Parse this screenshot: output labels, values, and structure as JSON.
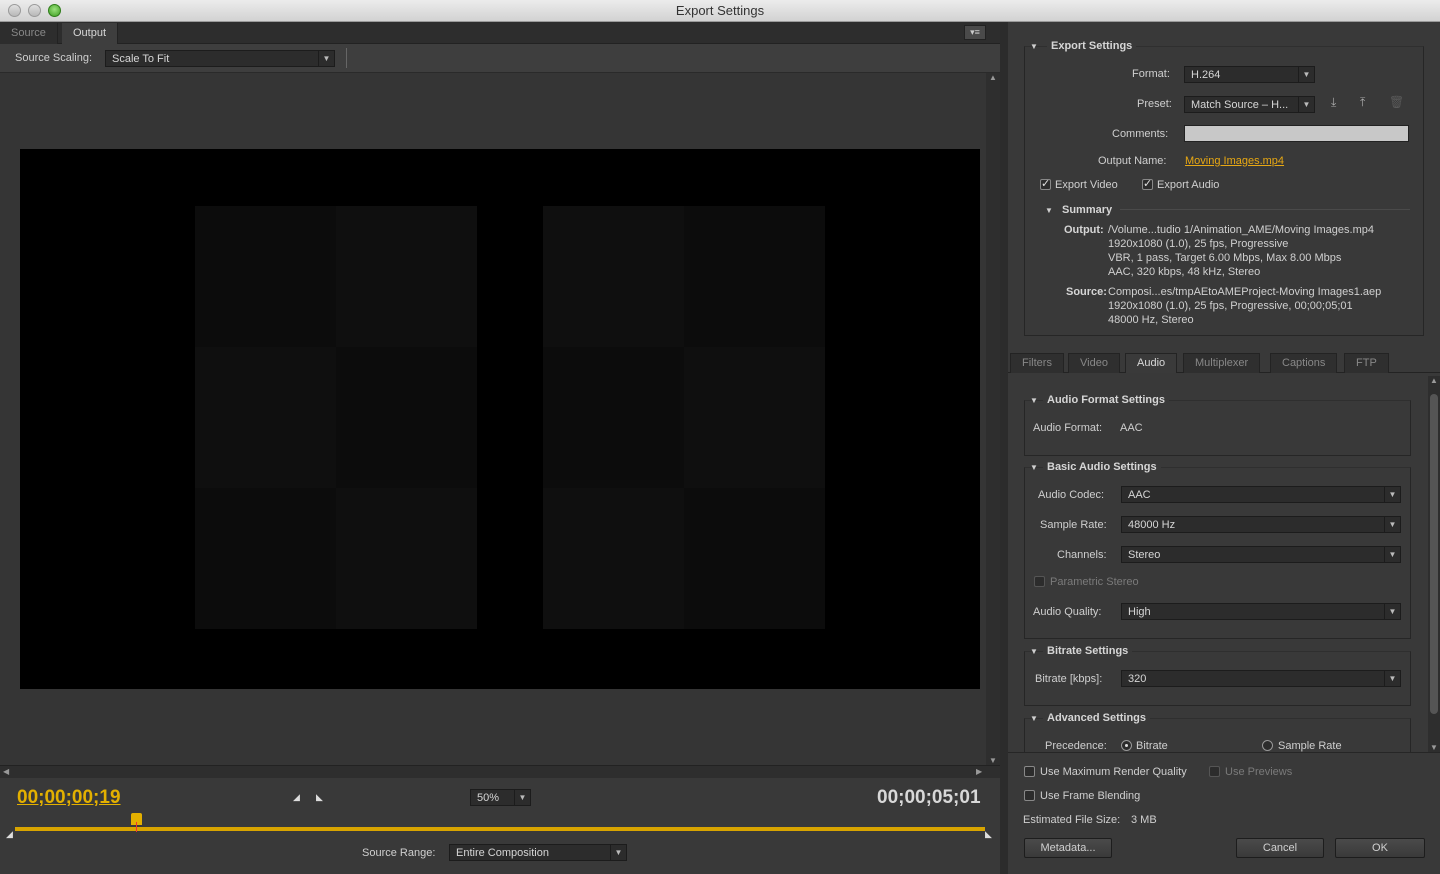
{
  "window": {
    "title": "Export Settings"
  },
  "left_tabs": [
    {
      "label": "Source"
    },
    {
      "label": "Output"
    }
  ],
  "scaling": {
    "label": "Source Scaling:",
    "value": "Scale To Fit"
  },
  "playback": {
    "current_time": "00;00;00;19",
    "end_time": "00;00;05;01",
    "zoom": "50%",
    "source_range_label": "Source Range:",
    "source_range_value": "Entire Composition",
    "playhead_fraction": 0.13
  },
  "export_settings": {
    "title": "Export Settings",
    "format_label": "Format:",
    "format_value": "H.264",
    "preset_label": "Preset:",
    "preset_value": "Match Source – H...",
    "comments_label": "Comments:",
    "comments_value": "",
    "output_name_label": "Output Name:",
    "output_name_value": "Moving Images.mp4",
    "export_video": "Export Video",
    "export_audio": "Export Audio",
    "summary_title": "Summary",
    "output_label": "Output:",
    "output_lines": [
      "/Volume...tudio 1/Animation_AME/Moving Images.mp4",
      "1920x1080 (1.0), 25 fps, Progressive",
      "VBR, 1 pass, Target 6.00 Mbps, Max 8.00 Mbps",
      "AAC, 320 kbps, 48 kHz, Stereo"
    ],
    "source_label": "Source:",
    "source_lines": [
      "Composi...es/tmpAEtoAMEProject-Moving Images1.aep",
      "1920x1080 (1.0), 25 fps, Progressive, 00;00;05;01",
      "48000 Hz, Stereo"
    ]
  },
  "right_tabs": [
    {
      "label": "Filters"
    },
    {
      "label": "Video"
    },
    {
      "label": "Audio"
    },
    {
      "label": "Multiplexer"
    },
    {
      "label": "Captions"
    },
    {
      "label": "FTP"
    }
  ],
  "audio": {
    "format_section": "Audio Format Settings",
    "format_label": "Audio Format:",
    "format_value": "AAC",
    "basic_section": "Basic Audio Settings",
    "codec_label": "Audio Codec:",
    "codec_value": "AAC",
    "sample_rate_label": "Sample Rate:",
    "sample_rate_value": "48000 Hz",
    "channels_label": "Channels:",
    "channels_value": "Stereo",
    "parametric_stereo": "Parametric Stereo",
    "quality_label": "Audio Quality:",
    "quality_value": "High",
    "bitrate_section": "Bitrate Settings",
    "bitrate_label": "Bitrate [kbps]:",
    "bitrate_value": "320",
    "advanced_section": "Advanced Settings",
    "precedence_label": "Precedence:",
    "precedence_bitrate": "Bitrate",
    "precedence_sample_rate": "Sample Rate"
  },
  "footer": {
    "max_render_quality": "Use Maximum Render Quality",
    "use_previews": "Use Previews",
    "frame_blending": "Use Frame Blending",
    "estimated_size_label": "Estimated File Size:",
    "estimated_size_value": "3 MB",
    "metadata_button": "Metadata...",
    "cancel_button": "Cancel",
    "ok_button": "OK"
  },
  "colors": {
    "accent": "#e8a813",
    "timecode": "#e3b000"
  }
}
